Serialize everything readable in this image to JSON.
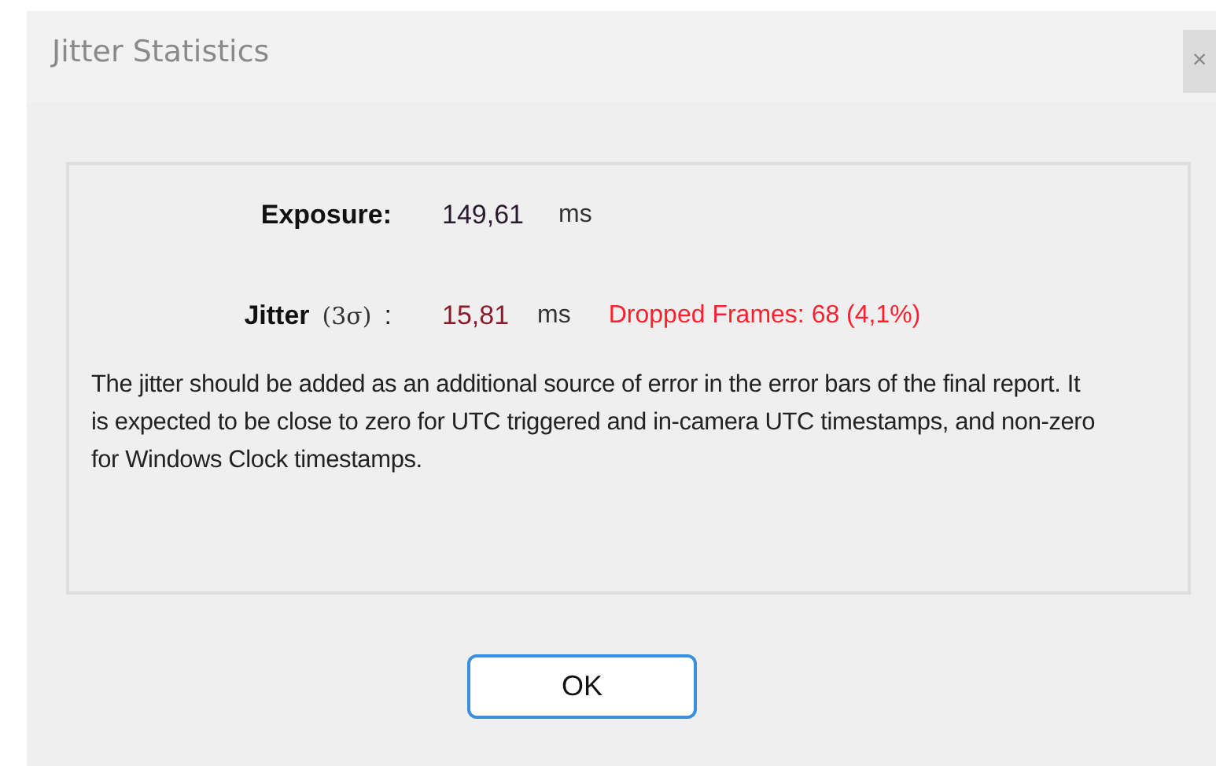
{
  "window": {
    "title": "Jitter Statistics",
    "close": "×"
  },
  "exposure": {
    "label": "Exposure:",
    "value": "149,61",
    "unit": "ms"
  },
  "jitter": {
    "label": "Jitter",
    "sigma": "(3σ)",
    "colon": ":",
    "value": "15,81",
    "unit": "ms",
    "dropped": "Dropped Frames: 68 (4,1%)"
  },
  "note": "The jitter should be added as an additional source of error in the error bars of the final report. It is expected to be close to zero for UTC triggered and in-camera UTC timestamps, and non-zero for Windows Clock timestamps.",
  "buttons": [
    "OK"
  ]
}
